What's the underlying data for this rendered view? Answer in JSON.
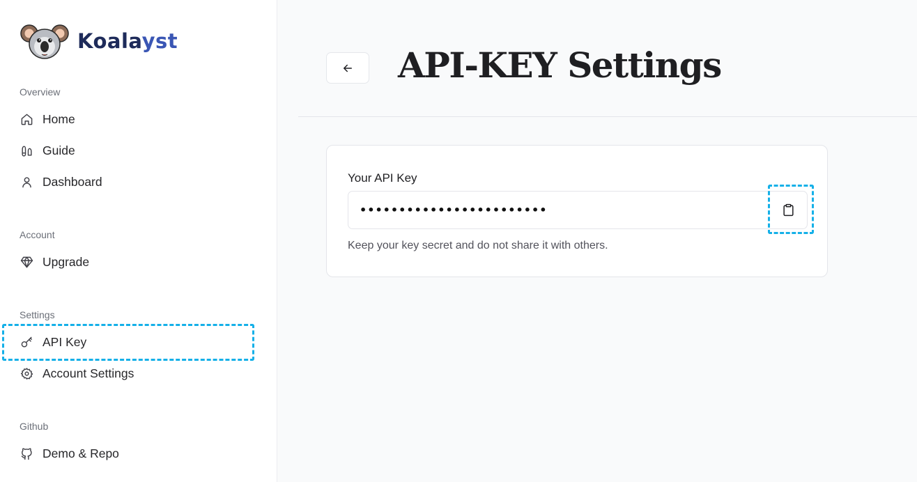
{
  "brand": {
    "name_dark": "Koala",
    "name_blue": "yst",
    "logo_icon": "koala-logo"
  },
  "sidebar": {
    "sections": [
      {
        "label": "Overview",
        "items": [
          {
            "label": "Home",
            "icon": "home-icon"
          },
          {
            "label": "Guide",
            "icon": "footprints-icon"
          },
          {
            "label": "Dashboard",
            "icon": "user-icon"
          }
        ]
      },
      {
        "label": "Account",
        "items": [
          {
            "label": "Upgrade",
            "icon": "gem-icon"
          }
        ]
      },
      {
        "label": "Settings",
        "items": [
          {
            "label": "API Key",
            "icon": "key-icon"
          },
          {
            "label": "Account Settings",
            "icon": "gear-icon"
          }
        ]
      },
      {
        "label": "Github",
        "items": [
          {
            "label": "Demo & Repo",
            "icon": "github-icon"
          }
        ]
      }
    ]
  },
  "main": {
    "title": "API-KEY Settings",
    "back_icon": "arrow-left-icon",
    "api_key": {
      "label": "Your API Key",
      "value": "••••••••••••••••••••••••",
      "copy_icon": "clipboard-icon",
      "helper": "Keep your key secret and do not share it with others."
    }
  },
  "colors": {
    "highlight": "#15b0e8",
    "brand_dark": "#1e2b5a",
    "brand_blue": "#3a56b4",
    "page_bg": "#f9fafb"
  }
}
